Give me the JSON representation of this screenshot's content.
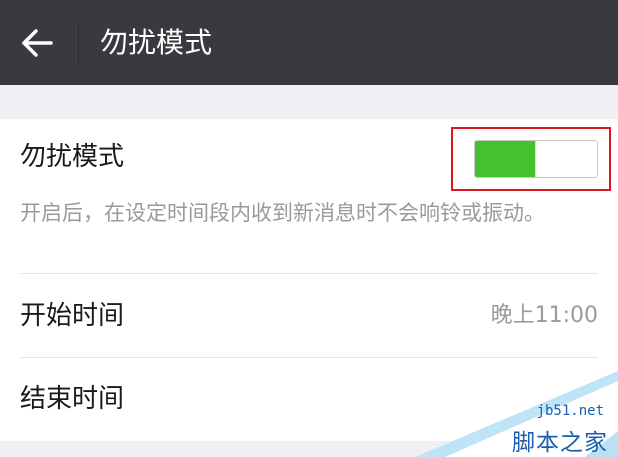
{
  "header": {
    "title": "勿扰模式"
  },
  "dnd": {
    "label": "勿扰模式",
    "enabled": true,
    "description": "开启后，在设定时间段内收到新消息时不会响铃或振动。"
  },
  "start": {
    "label": "开始时间",
    "value": "晚上11:00"
  },
  "end": {
    "label": "结束时间"
  },
  "watermark": {
    "url": "jb51.net",
    "name": "脚本之家"
  },
  "colors": {
    "topbar": "#393a3f",
    "toggle_on": "#44c12c",
    "highlight": "#d9171d",
    "watermark": "#1a5fae"
  },
  "icons": {
    "back": "arrow-left-icon"
  }
}
